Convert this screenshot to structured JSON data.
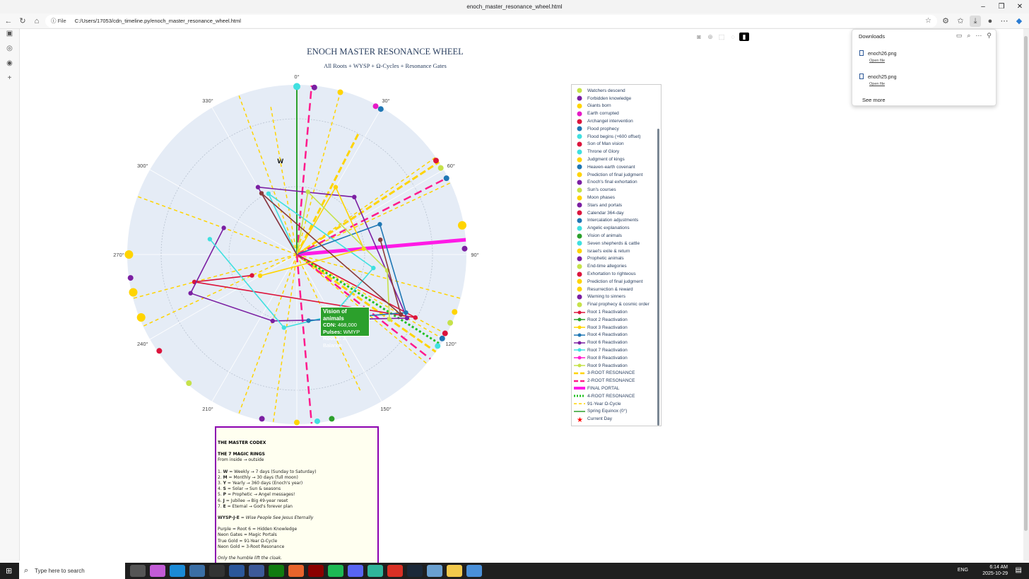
{
  "window": {
    "title": "enoch_master_resonance_wheel.html"
  },
  "address_bar": {
    "scheme_label": "File",
    "url": "C:/Users/17053/cdn_timeline.py/enoch_master_resonance_wheel.html"
  },
  "chart": {
    "title": "ENOCH MASTER RESONANCE WHEEL",
    "subtitle": "All Roots + WYSP + Ω-Cycles + Resonance Gates",
    "angle_ticks": [
      "0°",
      "30°",
      "60°",
      "90°",
      "120°",
      "150°",
      "210°",
      "240°",
      "270°",
      "300°",
      "330°"
    ],
    "ring_marker": "W"
  },
  "chart_data": {
    "type": "scatter",
    "projection": "polar",
    "angular_axis": {
      "rotation": "clockwise",
      "zero": "top",
      "tick_step_deg": 30
    },
    "legend_placement": "right",
    "series": [
      {
        "name": "Watchers descend",
        "color": "#c6e24a"
      },
      {
        "name": "Forbidden knowledge",
        "color": "#7b1fa2"
      },
      {
        "name": "Giants born",
        "color": "#ffd400"
      },
      {
        "name": "Earth corrupted",
        "color": "#e61ac6"
      },
      {
        "name": "Archangel intervention",
        "color": "#dc143c"
      },
      {
        "name": "Flood prophecy",
        "color": "#1f77b4"
      },
      {
        "name": "Flood begins (+600 offset)",
        "color": "#40e0e0"
      },
      {
        "name": "Son of Man vision",
        "color": "#dc143c"
      },
      {
        "name": "Throne of Glory",
        "color": "#40e0e0"
      },
      {
        "name": "Judgment of kings",
        "color": "#ffd400"
      },
      {
        "name": "Heaven-earth covenant",
        "color": "#1f77b4"
      },
      {
        "name": "Prediction of final judgment",
        "color": "#ffd400"
      },
      {
        "name": "Enoch's final exhortation",
        "color": "#7b1fa2"
      },
      {
        "name": "Sun's courses",
        "color": "#c6e24a"
      },
      {
        "name": "Moon phases",
        "color": "#ffd400"
      },
      {
        "name": "Stars and portals",
        "color": "#7b1fa2"
      },
      {
        "name": "Calendar 364-day",
        "color": "#dc143c"
      },
      {
        "name": "Intercalation adjustments",
        "color": "#1f77b4"
      },
      {
        "name": "Angelic explanations",
        "color": "#40e0e0"
      },
      {
        "name": "Vision of animals",
        "color": "#2ca02c"
      },
      {
        "name": "Seven shepherds & cattle",
        "color": "#40e0e0"
      },
      {
        "name": "Israel's exile & return",
        "color": "#ffd400"
      },
      {
        "name": "Prophetic animals",
        "color": "#7b1fa2"
      },
      {
        "name": "End-time allegories",
        "color": "#c6e24a"
      },
      {
        "name": "Exhortation to righteous",
        "color": "#dc143c"
      },
      {
        "name": "Prediction of final judgment",
        "color": "#ffd400"
      },
      {
        "name": "Resurrection & reward",
        "color": "#ffd400"
      },
      {
        "name": "Warning to sinners",
        "color": "#7b1fa2"
      },
      {
        "name": "Final prophecy & cosmic order",
        "color": "#c6e24a"
      },
      {
        "name": "Root 1 Reactivation",
        "color": "#dc143c"
      },
      {
        "name": "Root 2 Reactivation",
        "color": "#2ca02c"
      },
      {
        "name": "Root 3 Reactivation",
        "color": "#ffd400"
      },
      {
        "name": "Root 4 Reactivation",
        "color": "#1f77b4"
      },
      {
        "name": "Root 6 Reactivation",
        "color": "#7b1fa2"
      },
      {
        "name": "Root 7 Reactivation",
        "color": "#40e0e0"
      },
      {
        "name": "Root 8 Reactivation",
        "color": "#ff1ecf"
      },
      {
        "name": "Root 9 Reactivation",
        "color": "#c6e24a"
      },
      {
        "name": "3-ROOT RESONANCE",
        "color": "#ffd400"
      },
      {
        "name": "2-ROOT RESONANCE",
        "color": "#ff1a8c"
      },
      {
        "name": "FINAL PORTAL",
        "color": "#ff1ae6"
      },
      {
        "name": "4-ROOT RESONANCE",
        "color": "#22c022"
      },
      {
        "name": "91-Year Ω-Cycle",
        "color": "#ffd400"
      },
      {
        "name": "Spring Equinox (0°)",
        "color": "#2ca02c"
      },
      {
        "name": "Current Day",
        "color": "#ff0000"
      }
    ],
    "tooltip": {
      "series": "Vision of animals",
      "cdn_label": "CDN:",
      "cdn": "468,000",
      "pulses_label": "Pulses:",
      "pulses": "WMYP",
      "root_label": "Root 2:",
      "root": "2: Balance"
    }
  },
  "codex": {
    "title": "THE MASTER CODEX",
    "rings_title": "THE 7 MAGIC RINGS",
    "rings_note": "From inside → outside",
    "rings": [
      {
        "n": "1.",
        "k": "W",
        "t": " = Weekly → 7 days (Sunday to Saturday)"
      },
      {
        "n": "2.",
        "k": "M",
        "t": " = Monthly → 30 days (full moon)"
      },
      {
        "n": "3.",
        "k": "Y",
        "t": " = Yearly → 360 days (Enoch's year)"
      },
      {
        "n": "4.",
        "k": "S",
        "t": " = Solar → Sun & seasons"
      },
      {
        "n": "5.",
        "k": "P",
        "t": " = Prophetic → Angel messages!"
      },
      {
        "n": "6.",
        "k": "J",
        "t": " = Jubilee → Big 49-year reset"
      },
      {
        "n": "7.",
        "k": "E",
        "t": " = Eternal → God's forever plan"
      }
    ],
    "wysp_key": "WYSP-J-E",
    "wysp_text": " = Wise People See Jesus Eternally",
    "colors": [
      "Purple = Root 6 = Hidden Knowledge",
      "Neon Gates = Magic Portals",
      "True Gold = 91-Year Ω-Cycle",
      "Neon Gold = 3-Root Resonance"
    ],
    "footer": "Only the humble lift the cloak."
  },
  "downloads": {
    "title": "Downloads",
    "items": [
      {
        "name": "enoch26.png",
        "action": "Open file"
      },
      {
        "name": "enoch25.png",
        "action": "Open file"
      }
    ],
    "see_more": "See more"
  },
  "taskbar": {
    "search_placeholder": "Type here to search",
    "lang": "ENG",
    "time": "6:14 AM",
    "date": "2025-10-29"
  }
}
